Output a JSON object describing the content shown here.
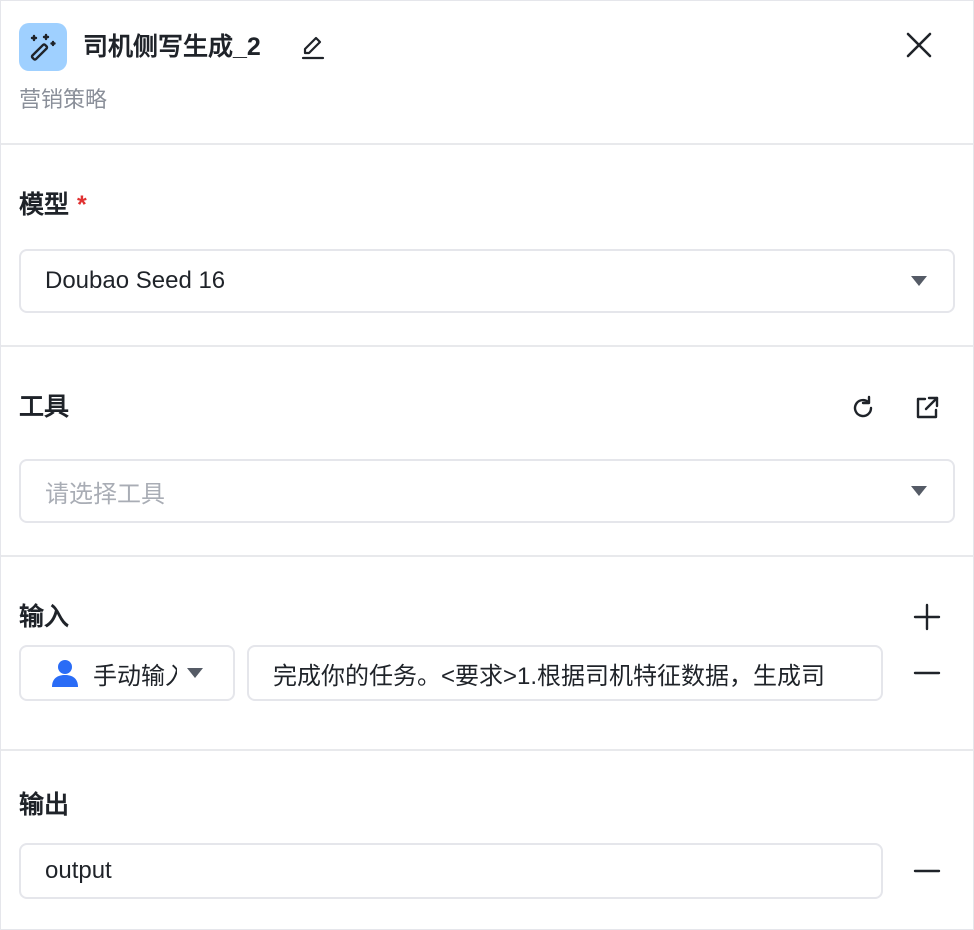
{
  "header": {
    "title": "司机侧写生成_2",
    "subtitle": "营销策略",
    "app_icon": "magic-wand-icon",
    "accent_color": "#9fd0ff"
  },
  "model": {
    "label": "模型",
    "required_mark": "*",
    "selected": "Doubao Seed 16"
  },
  "tools": {
    "label": "工具",
    "placeholder": "请选择工具"
  },
  "input": {
    "label": "输入",
    "mode": "手动输入",
    "value": "完成你的任务。<要求>1.根据司机特征数据，生成司"
  },
  "output": {
    "label": "输出",
    "value": "output"
  }
}
